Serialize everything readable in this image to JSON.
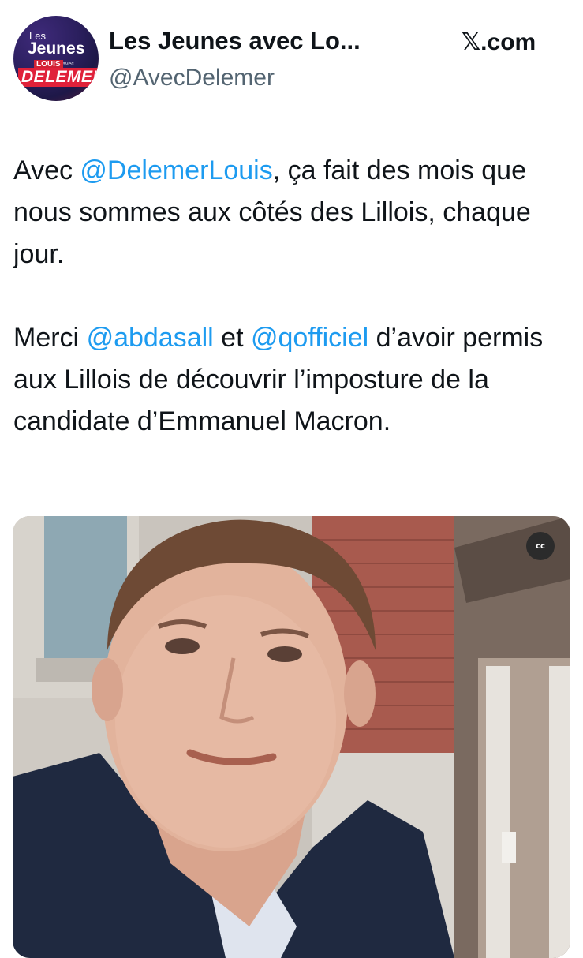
{
  "account": {
    "display_name": "Les Jeunes avec Lo...",
    "handle": "@AvecDelemer",
    "avatar_logo": {
      "line1": "Les",
      "line2": "Jeunes",
      "line3": "avec",
      "line4": "LOUIS",
      "line5": "DELEMER"
    }
  },
  "source": {
    "site_prefix": "𝕏",
    "site_suffix": ".com"
  },
  "tweet": {
    "paragraph1": [
      {
        "text": "Avec ",
        "mention": false
      },
      {
        "text": "@DelemerLouis",
        "mention": true
      },
      {
        "text": ", ça fait des mois que nous sommes aux côtés des Lillois, chaque jour.",
        "mention": false
      }
    ],
    "paragraph2": [
      {
        "text": "Merci ",
        "mention": false
      },
      {
        "text": "@abdasall",
        "mention": true
      },
      {
        "text": " et ",
        "mention": false
      },
      {
        "text": "@qofficiel",
        "mention": true
      },
      {
        "text": " d’avoir permis aux Lillois de découvrir l’imposture de la candidate d’Emmanuel Macron.",
        "mention": false
      }
    ]
  },
  "media": {
    "caption_badge": "cc"
  },
  "colors": {
    "mention": "#1d9bf0",
    "text": "#0f1419",
    "secondary": "#536471"
  }
}
